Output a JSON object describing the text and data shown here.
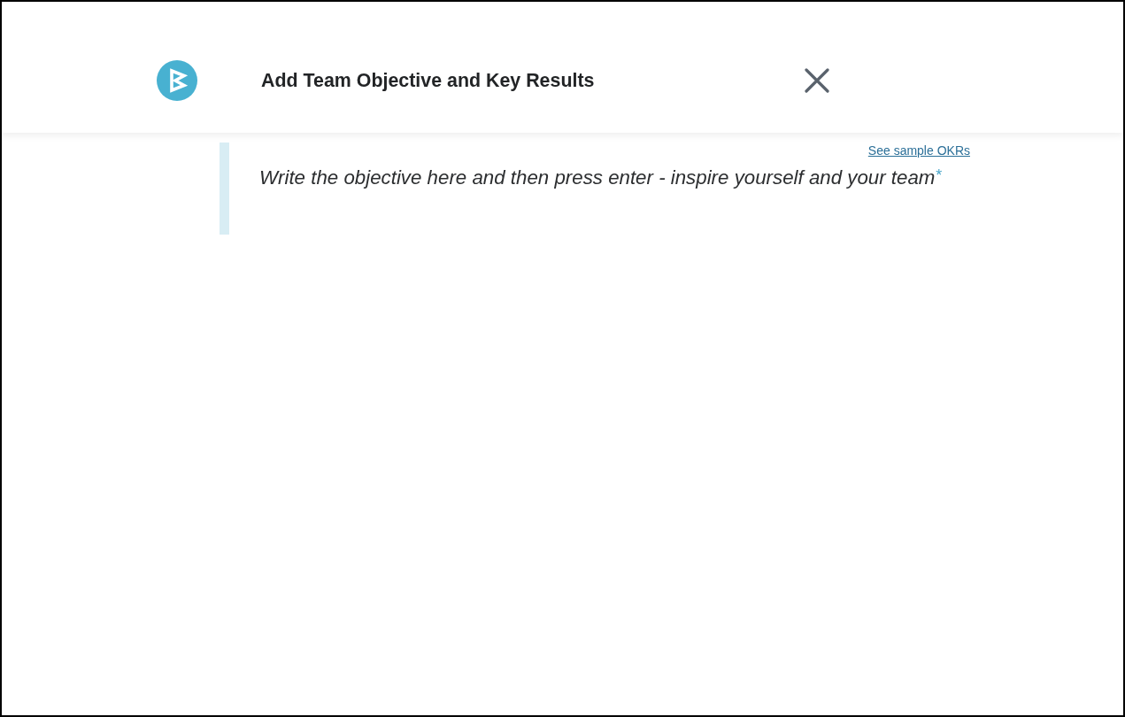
{
  "header": {
    "title": "Add Team Objective and Key Results"
  },
  "objective": {
    "link": "See sample OKRs",
    "placeholder": "Write the objective here and then press enter - inspire yourself and your team",
    "required_mark": "*"
  }
}
